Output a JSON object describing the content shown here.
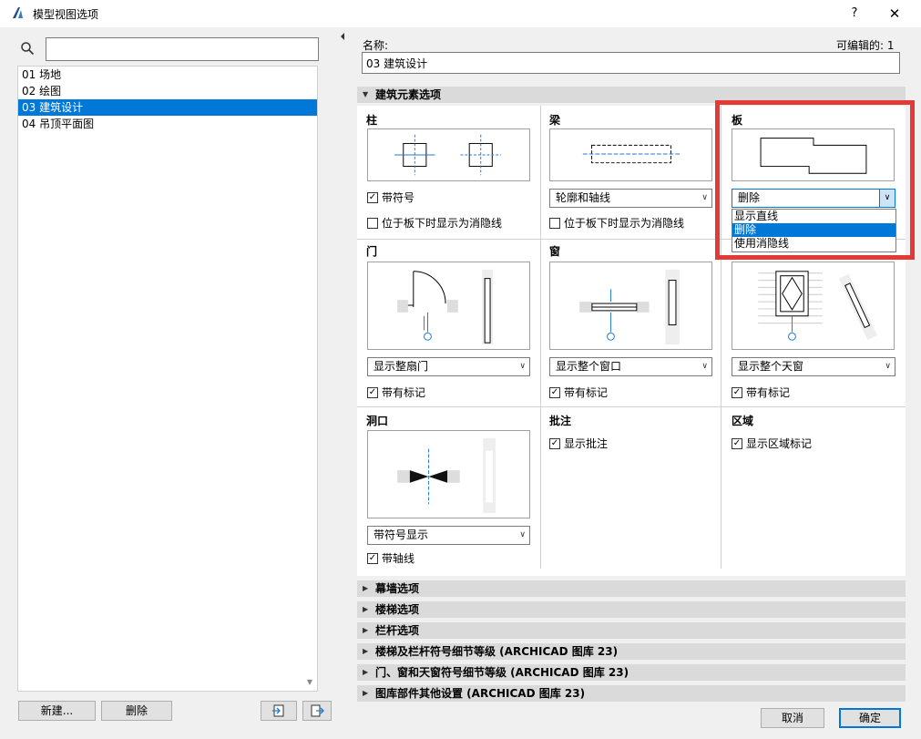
{
  "window": {
    "title": "模型视图选项",
    "help": "?",
    "close": "✕"
  },
  "left": {
    "search_value": "",
    "items": [
      "01 场地",
      "02 绘图",
      "03 建筑设计",
      "04 吊顶平面图"
    ],
    "selected_index": 2,
    "new_button": "新建...",
    "delete_button": "删除"
  },
  "right": {
    "name_label": "名称:",
    "editable_label": "可编辑的:",
    "editable_count": "1",
    "name_value": "03 建筑设计",
    "section_main": "建筑元素选项",
    "cells": {
      "column": {
        "title": "柱",
        "check1": "带符号",
        "check1_on": true,
        "check2": "位于板下时显示为消隐线",
        "check2_on": false
      },
      "beam": {
        "title": "梁",
        "select": "轮廓和轴线",
        "check2": "位于板下时显示为消隐线",
        "check2_on": false
      },
      "slab": {
        "title": "板",
        "select": "删除",
        "options": [
          "显示直线",
          "删除",
          "使用消隐线"
        ],
        "highlighted": 1
      },
      "door": {
        "title": "门",
        "select": "显示整扇门",
        "check": "带有标记",
        "check_on": true
      },
      "window": {
        "title": "窗",
        "select": "显示整个窗口",
        "check": "带有标记",
        "check_on": true
      },
      "skylight": {
        "select": "显示整个天窗",
        "check": "带有标记",
        "check_on": true
      },
      "opening": {
        "title": "洞口",
        "select": "带符号显示",
        "check": "带轴线",
        "check_on": true
      },
      "annotation": {
        "title": "批注",
        "check": "显示批注",
        "check_on": true
      },
      "zone": {
        "title": "区域",
        "check": "显示区域标记",
        "check_on": true
      }
    },
    "collapsed_sections": [
      "幕墙选项",
      "楼梯选项",
      "栏杆选项",
      "楼梯及栏杆符号细节等级 (ARCHICAD 图库 23)",
      "门、窗和天窗符号细节等级 (ARCHICAD 图库 23)",
      "图库部件其他设置 (ARCHICAD 图库 23)"
    ],
    "cancel_button": "取消",
    "ok_button": "确定"
  },
  "colors": {
    "accent": "#0078d7",
    "highlight_box": "#e53935",
    "axis_blue": "#1f7ad1"
  },
  "icons": {
    "app": "archicad-logo-icon",
    "search": "search-icon",
    "import": "import-icon",
    "export": "export-icon"
  }
}
